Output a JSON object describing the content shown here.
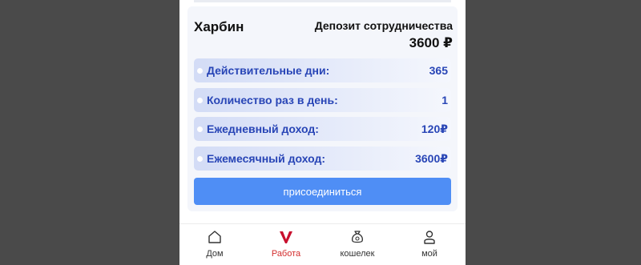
{
  "plan": {
    "city": "Харбин",
    "deposit_label": "Депозит сотрудничества",
    "deposit_value": "3600 ₽"
  },
  "rows": [
    {
      "label": "Действительные дни:",
      "value": "365"
    },
    {
      "label": "Количество раз в день:",
      "value": "1"
    },
    {
      "label": "Ежедневный доход:",
      "value": "120₽"
    },
    {
      "label": "Ежемесячный доход:",
      "value": "3600₽"
    }
  ],
  "join_label": "присоединиться",
  "tabs": [
    {
      "label": "Дом",
      "icon": "home-icon"
    },
    {
      "label": "Работа",
      "icon": "work-v-icon"
    },
    {
      "label": "кошелек",
      "icon": "wallet-icon"
    },
    {
      "label": "мой",
      "icon": "profile-icon"
    }
  ],
  "colors": {
    "accent": "#4f8ef5",
    "row_text": "#2845b6",
    "active_tab": "#d32d2d",
    "backdrop": "#4a4a4a"
  }
}
